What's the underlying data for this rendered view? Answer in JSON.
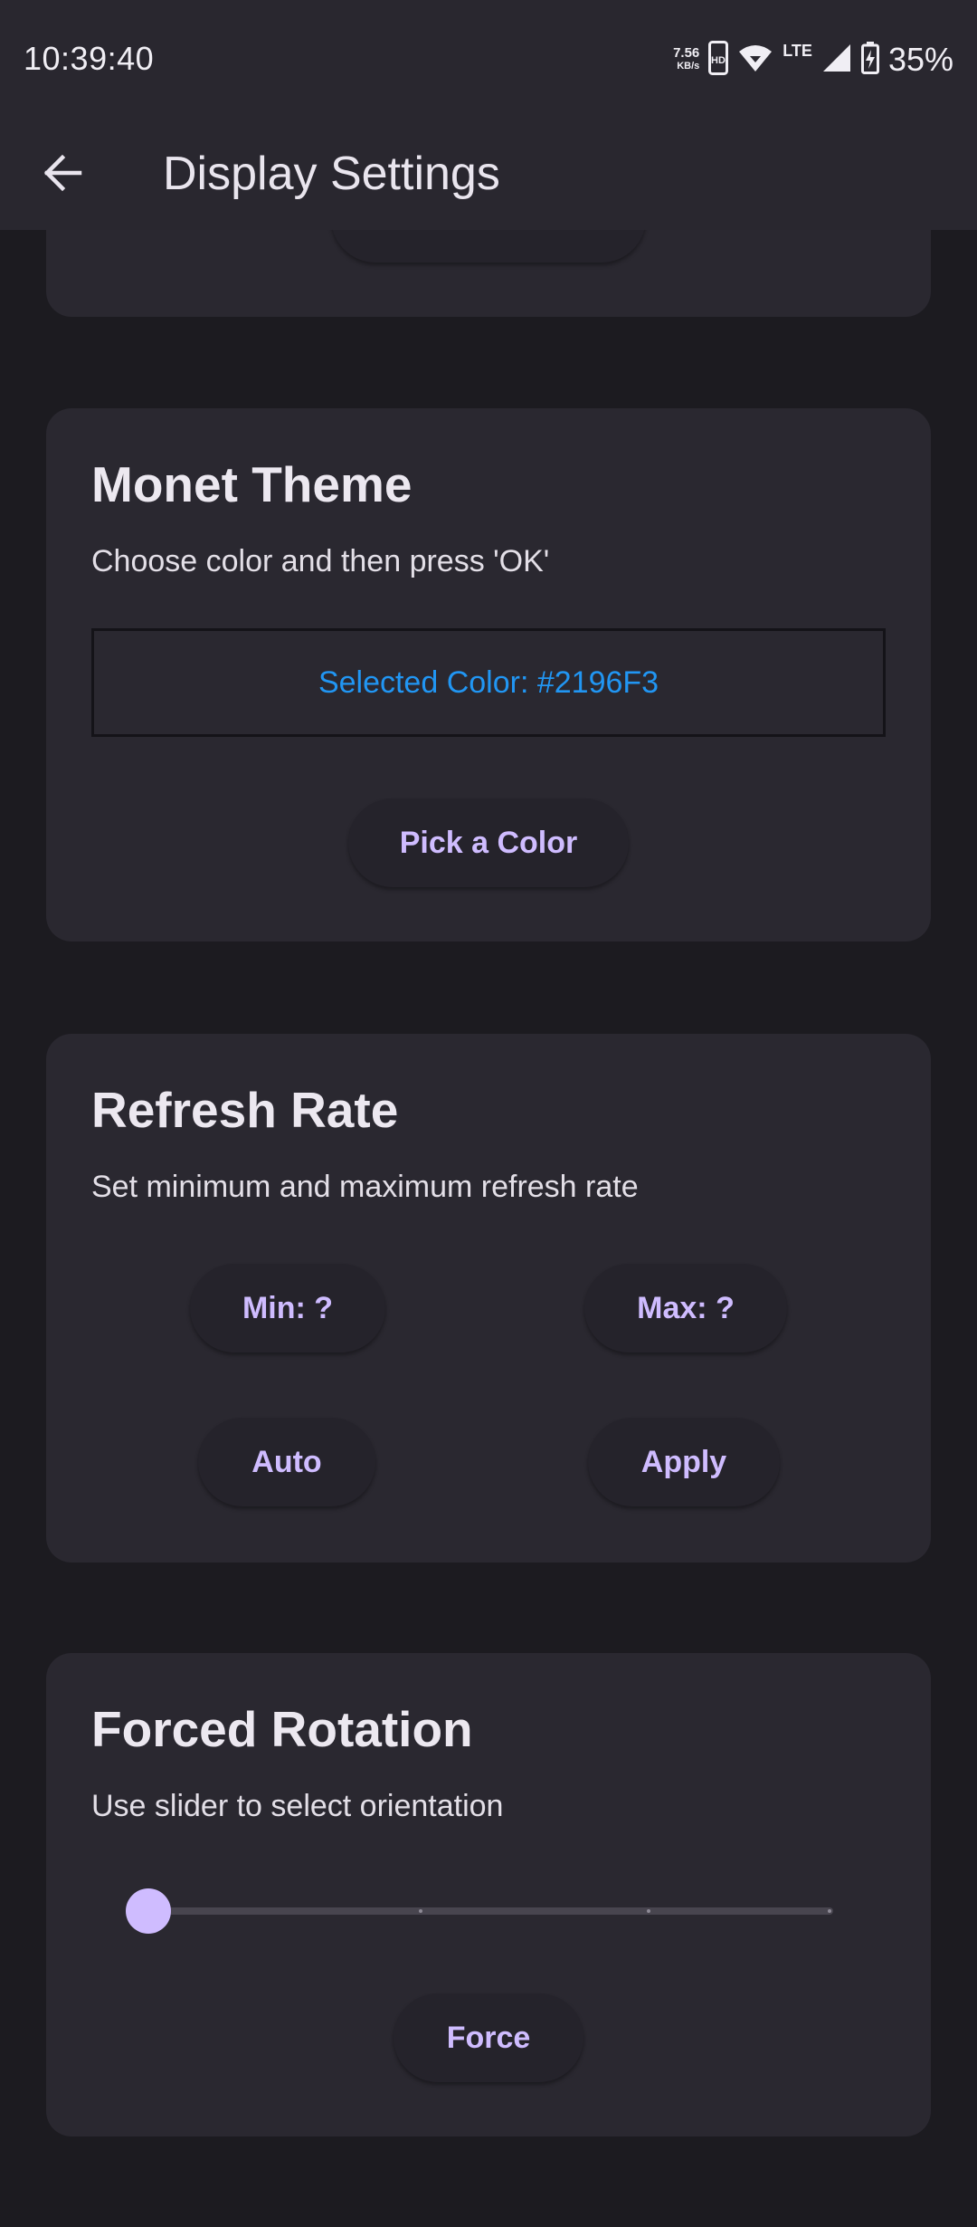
{
  "status_bar": {
    "time": "10:39:40",
    "net_speed_value": "7.56",
    "net_speed_unit": "KB/s",
    "hd_badge": "HD",
    "network_type": "LTE",
    "battery_percent": "35%",
    "icons": [
      "hd-icon",
      "wifi-icon",
      "cell-signal-icon",
      "battery-charging-icon"
    ]
  },
  "app_bar": {
    "title": "Display Settings",
    "back_icon": "arrow-back-icon"
  },
  "monet": {
    "title": "Monet Theme",
    "description": "Choose color and then press 'OK'",
    "selected_color_label": "Selected Color: #2196F3",
    "selected_color_hex": "#2196F3",
    "pick_button": "Pick a Color"
  },
  "refresh_rate": {
    "title": "Refresh Rate",
    "description": "Set minimum and maximum refresh rate",
    "min_button": "Min: ?",
    "max_button": "Max: ?",
    "auto_button": "Auto",
    "apply_button": "Apply"
  },
  "rotation": {
    "title": "Forced Rotation",
    "description": "Use slider to select orientation",
    "slider_value": 0,
    "slider_steps": 4,
    "force_button": "Force"
  },
  "colors": {
    "background": "#1c1b20",
    "surface": "#2a2830",
    "accent": "#cfbcff",
    "selected_color": "#2196f3"
  }
}
